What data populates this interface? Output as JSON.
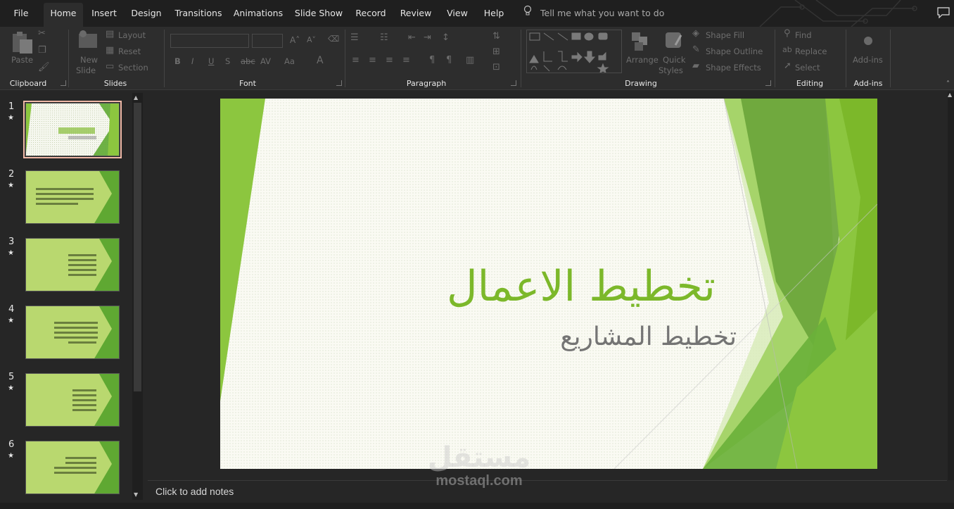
{
  "tabs": [
    {
      "label": "File"
    },
    {
      "label": "Home"
    },
    {
      "label": "Insert"
    },
    {
      "label": "Design"
    },
    {
      "label": "Transitions"
    },
    {
      "label": "Animations"
    },
    {
      "label": "Slide Show"
    },
    {
      "label": "Record"
    },
    {
      "label": "Review"
    },
    {
      "label": "View"
    },
    {
      "label": "Help"
    }
  ],
  "tell_me": "Tell me what you want to do",
  "ribbon": {
    "clipboard": {
      "label": "Clipboard",
      "paste": "Paste"
    },
    "slides": {
      "label": "Slides",
      "new_slide_1": "New",
      "new_slide_2": "Slide",
      "layout": "Layout",
      "reset": "Reset",
      "section": "Section"
    },
    "font": {
      "label": "Font"
    },
    "paragraph": {
      "label": "Paragraph"
    },
    "drawing": {
      "label": "Drawing",
      "arrange": "Arrange",
      "quick_1": "Quick",
      "quick_2": "Styles",
      "shape_fill": "Shape Fill",
      "shape_outline": "Shape Outline",
      "shape_effects": "Shape Effects"
    },
    "editing": {
      "label": "Editing",
      "find": "Find",
      "replace": "Replace",
      "select": "Select"
    },
    "addins": {
      "label": "Add-ins",
      "addins_btn": "Add-ins"
    }
  },
  "thumbnails": [
    {
      "number": "1",
      "star": "★"
    },
    {
      "number": "2",
      "star": "★"
    },
    {
      "number": "3",
      "star": "★"
    },
    {
      "number": "4",
      "star": "★"
    },
    {
      "number": "5",
      "star": "★"
    },
    {
      "number": "6",
      "star": "★"
    }
  ],
  "slide": {
    "title": "تخطيط الاعمال",
    "subtitle": "تخطيط المشاريع"
  },
  "notes_placeholder": "Click to add notes",
  "watermark": {
    "arabic": "مستقل",
    "latin": "mostaql.com"
  },
  "colors": {
    "accent_green": "#7cb82a",
    "ribbon_bg": "#2d2d2d",
    "tab_bg": "#1f1f1f"
  }
}
